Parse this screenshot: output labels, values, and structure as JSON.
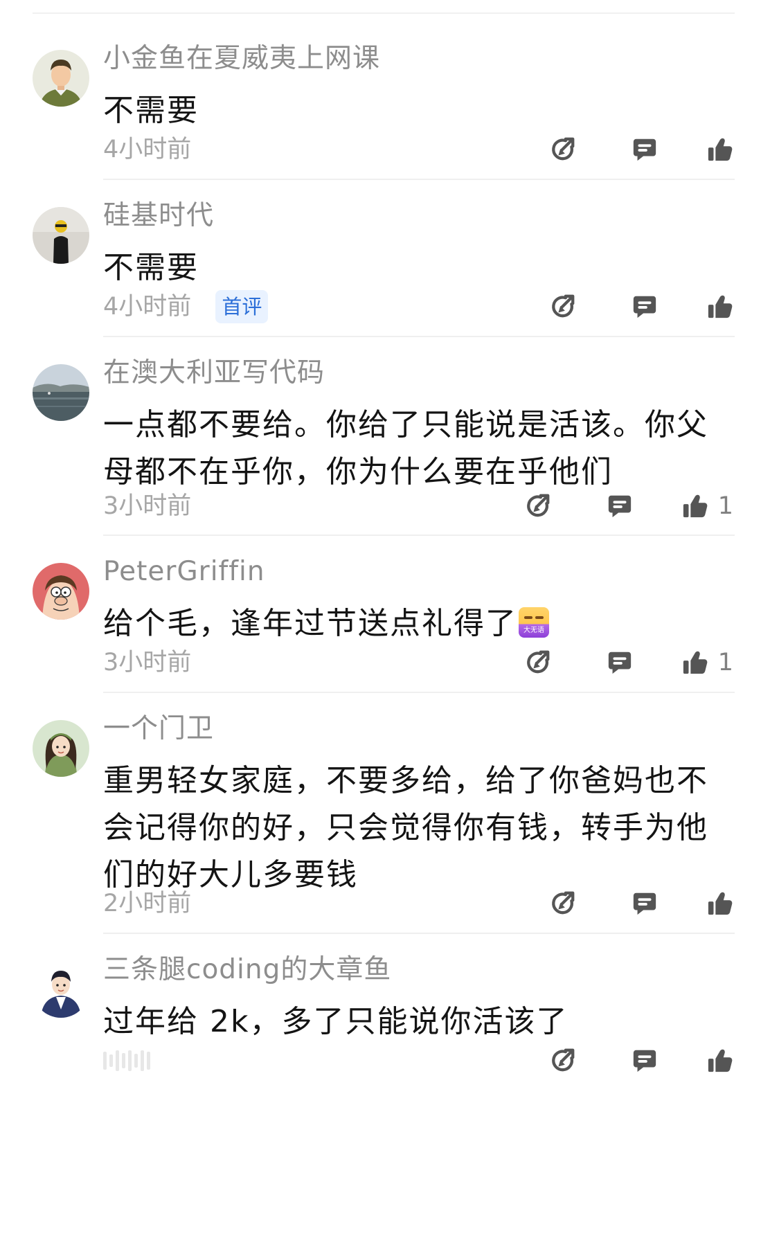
{
  "colors": {
    "username": "#8d8d8d",
    "content": "#141414",
    "time": "#a6a6a6",
    "icon": "#555555",
    "badge_bg": "#e9f2ff",
    "badge_text": "#2c6fd8"
  },
  "action_icons": [
    "share-icon",
    "reply-icon",
    "like-icon"
  ],
  "comments": [
    {
      "username": "小金鱼在夏威夷上网课",
      "content": "不需要",
      "time": "4小时前",
      "badge": "",
      "likes": ""
    },
    {
      "username": "硅基时代",
      "content": "不需要",
      "time": "4小时前",
      "badge": "首评",
      "likes": ""
    },
    {
      "username": "在澳大利亚写代码",
      "content": "一点都不要给。你给了只能说是活该。你父母都不在乎你，你为什么要在乎他们",
      "time": "3小时前",
      "badge": "",
      "likes": "1"
    },
    {
      "username": "PeterGriffin",
      "content": "给个毛，逢年过节送点礼得了",
      "time": "3小时前",
      "badge": "",
      "likes": "1",
      "emoji": "大无语",
      "emoji_icon": "speechless-emoji-icon"
    },
    {
      "username": "一个门卫",
      "content": "重男轻女家庭，不要多给，给了你爸妈也不会记得你的好，只会觉得你有钱，转手为他们的好大儿多要钱",
      "time": "2小时前",
      "badge": "",
      "likes": ""
    },
    {
      "username": "三条腿coding的大章鱼",
      "content": "过年给 2k，多了只能说你活该了",
      "time": "",
      "badge": "",
      "likes": ""
    }
  ]
}
